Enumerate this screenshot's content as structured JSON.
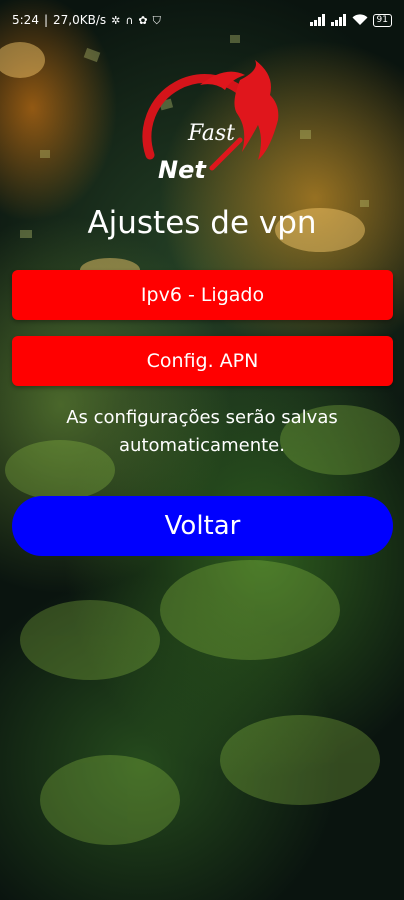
{
  "status_bar": {
    "time": "5:24",
    "network_speed": "27,0KB/s",
    "battery_level": "91",
    "left_icons": [
      "fan-icon",
      "headphones-icon",
      "settings-icon",
      "shield-icon"
    ],
    "right_icons": [
      "signal-icon",
      "signal-icon",
      "wifi-icon",
      "battery-icon"
    ]
  },
  "logo": {
    "line1": "Fast",
    "line2": "Net"
  },
  "page": {
    "title": "Ajustes de vpn",
    "ipv6_button": "Ipv6 - Ligado",
    "apn_button": "Config. APN",
    "notice": "As configurações serão salvas automaticamente.",
    "back_button": "Voltar"
  },
  "colors": {
    "primary_red": "#ff0000",
    "back_blue": "#0000ff",
    "text": "#ffffff"
  }
}
